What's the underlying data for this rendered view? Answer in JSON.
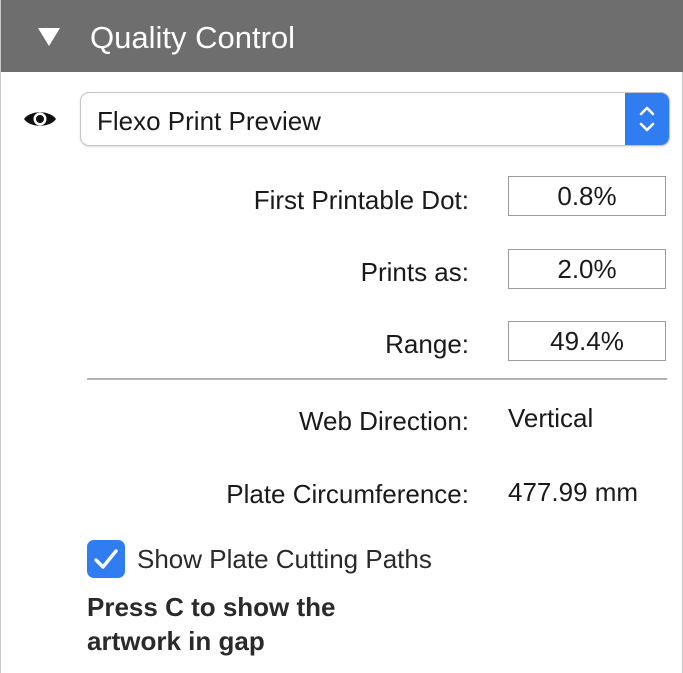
{
  "panel": {
    "title": "Quality Control",
    "collapse_icon": "disclosure-triangle-down"
  },
  "preview": {
    "visibility_icon": "eye-icon",
    "selected": "Flexo Print Preview",
    "stepper_icon": "up-down-chevron"
  },
  "fields": [
    {
      "label": "First Printable Dot:",
      "value": "0.8%"
    },
    {
      "label": "Prints as:",
      "value": "2.0%"
    },
    {
      "label": "Range:",
      "value": "49.4%"
    }
  ],
  "info": [
    {
      "label": "Web Direction:",
      "value": "Vertical"
    },
    {
      "label": "Plate Circumference:",
      "value": "477.99 mm"
    }
  ],
  "option": {
    "label": "Show Plate Cutting Paths",
    "checked": true
  },
  "hint": {
    "line1": "Press C to show the",
    "line2": "artwork in gap"
  },
  "colors": {
    "header_bg": "#6e6e6e",
    "accent": "#2f7df0"
  }
}
